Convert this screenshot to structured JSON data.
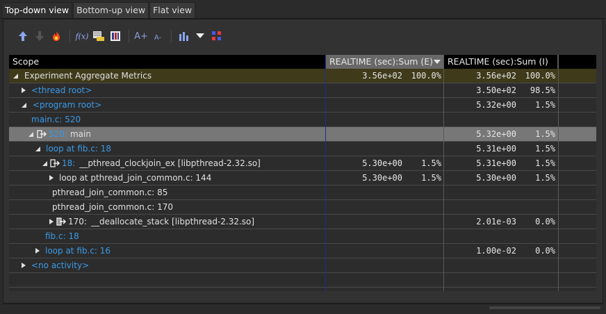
{
  "tabs": [
    {
      "label": "Top-down view",
      "active": true
    },
    {
      "label": "Bottom-up view",
      "active": false
    },
    {
      "label": "Flat view",
      "active": false
    }
  ],
  "toolbar": {
    "icons": [
      "arrow-up-icon",
      "arrow-down-icon",
      "flame-icon",
      "formula-icon",
      "csv-export-icon",
      "column-chooser-icon",
      "font-increase-icon",
      "font-decrease-icon",
      "graph-icon",
      "dropdown-icon",
      "thread-view-icon"
    ],
    "labels": {
      "formula": "f(x)",
      "csv": "CSV",
      "font_up": "A+",
      "font_down": "A-"
    }
  },
  "table": {
    "columns": {
      "scope": "Scope",
      "exclusive": "REALTIME (sec):Sum (E)",
      "inclusive": "REALTIME (sec):Sum (I)"
    },
    "rows": [
      {
        "label": "Experiment Aggregate Metrics",
        "e_val": "3.56e+02",
        "e_pct": "100.0%",
        "i_val": "3.56e+02",
        "i_pct": "100.0%"
      },
      {
        "label": "<thread root>",
        "e_val": "",
        "e_pct": "",
        "i_val": "3.50e+02",
        "i_pct": "98.5%"
      },
      {
        "label": "<program root>",
        "e_val": "",
        "e_pct": "",
        "i_val": "5.32e+00",
        "i_pct": "1.5%"
      },
      {
        "label": "main.c: 520",
        "e_val": "",
        "e_pct": "",
        "i_val": "",
        "i_pct": ""
      },
      {
        "num": "520:",
        "label": "main",
        "e_val": "",
        "e_pct": "",
        "i_val": "5.32e+00",
        "i_pct": "1.5%"
      },
      {
        "label": "loop at fib.c: 18",
        "e_val": "",
        "e_pct": "",
        "i_val": "5.31e+00",
        "i_pct": "1.5%"
      },
      {
        "num": "18:",
        "label": "__pthread_clockjoin_ex [libpthread-2.32.so]",
        "e_val": "5.30e+00",
        "e_pct": "1.5%",
        "i_val": "5.31e+00",
        "i_pct": "1.5%"
      },
      {
        "label": "loop at pthread_join_common.c: 144",
        "e_val": "5.30e+00",
        "e_pct": "1.5%",
        "i_val": "5.30e+00",
        "i_pct": "1.5%"
      },
      {
        "label": "pthread_join_common.c: 85",
        "e_val": "",
        "e_pct": "",
        "i_val": "",
        "i_pct": ""
      },
      {
        "label": "pthread_join_common.c: 170",
        "e_val": "",
        "e_pct": "",
        "i_val": "",
        "i_pct": ""
      },
      {
        "num": "170:",
        "label": "__deallocate_stack [libpthread-2.32.so]",
        "e_val": "",
        "e_pct": "",
        "i_val": "2.01e-03",
        "i_pct": "0.0%"
      },
      {
        "label": "fib.c: 18",
        "e_val": "",
        "e_pct": "",
        "i_val": "",
        "i_pct": ""
      },
      {
        "label": "loop at fib.c: 16",
        "e_val": "",
        "e_pct": "",
        "i_val": "1.00e-02",
        "i_pct": "0.0%"
      },
      {
        "label": "<no activity>",
        "e_val": "",
        "e_pct": "",
        "i_val": "",
        "i_pct": ""
      }
    ]
  },
  "colors": {
    "link": "#3a9ae8",
    "header_bg": "#000000",
    "sorted_header_bg": "#686868",
    "selected_row": "#777777",
    "top_row": "#3e3a1a"
  }
}
